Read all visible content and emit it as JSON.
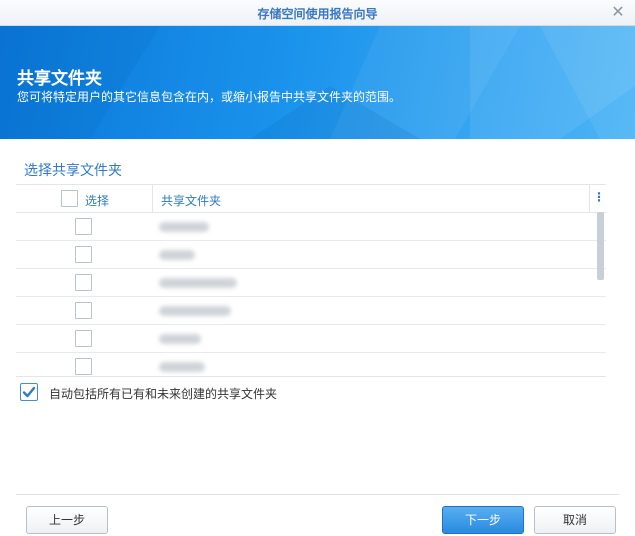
{
  "window": {
    "title": "存储空间使用报告向导",
    "close_symbol": "✕"
  },
  "banner": {
    "title": "共享文件夹",
    "subtitle": "您可将特定用户的其它信息包含在内，或缩小报告中共享文件夹的范围。"
  },
  "section": {
    "title": "选择共享文件夹"
  },
  "grid": {
    "columns": {
      "select": "选择",
      "name": "共享文件夹",
      "menu": "⋮"
    },
    "rows": [
      {
        "checked": false,
        "name_hidden": true
      },
      {
        "checked": false,
        "name_hidden": true
      },
      {
        "checked": false,
        "name_hidden": true
      },
      {
        "checked": false,
        "name_hidden": true
      },
      {
        "checked": false,
        "name_hidden": true
      },
      {
        "checked": false,
        "name_hidden": true
      }
    ]
  },
  "auto_include": {
    "checked": true,
    "label": "自动包括所有已有和未来创建的共享文件夹"
  },
  "buttons": {
    "prev": "上一步",
    "next": "下一步",
    "cancel": "取消"
  },
  "colors": {
    "accent": "#2f7bc5",
    "banner": "#1a93ec",
    "primary_button": "#2b8ae0"
  }
}
